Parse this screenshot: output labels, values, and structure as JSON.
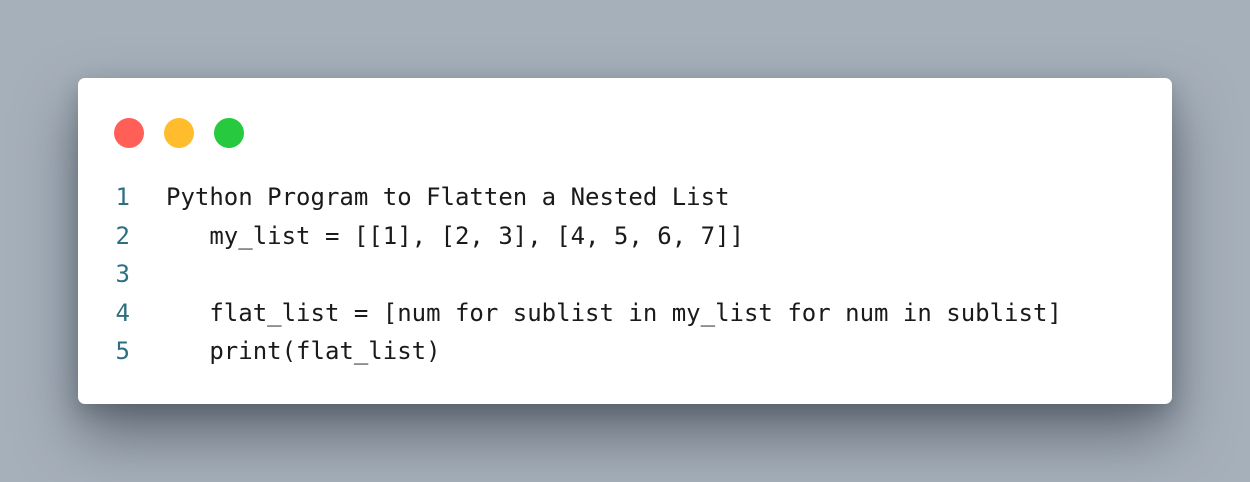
{
  "window": {
    "controls": [
      {
        "name": "close",
        "color": "#ff5f56"
      },
      {
        "name": "minimize",
        "color": "#ffbd2e"
      },
      {
        "name": "maximize",
        "color": "#27c93f"
      }
    ]
  },
  "code": {
    "line_number_color": "#2d6e82",
    "lines": [
      {
        "number": "1",
        "text": "Python Program to Flatten a Nested List"
      },
      {
        "number": "2",
        "text": "   my_list = [[1], [2, 3], [4, 5, 6, 7]]"
      },
      {
        "number": "3",
        "text": ""
      },
      {
        "number": "4",
        "text": "   flat_list = [num for sublist in my_list for num in sublist]"
      },
      {
        "number": "5",
        "text": "   print(flat_list)"
      }
    ]
  }
}
